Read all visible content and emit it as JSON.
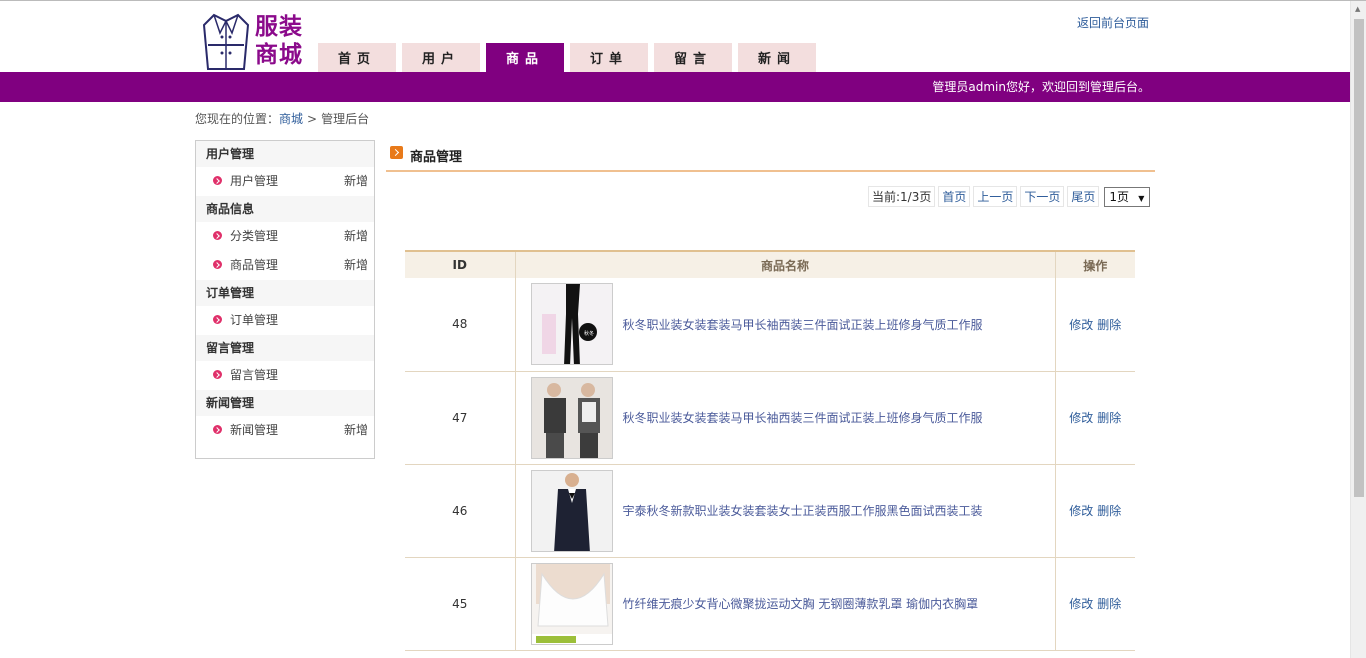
{
  "header": {
    "logo_text_1": "服装",
    "logo_text_2": "商城",
    "back_link": "返回前台页面",
    "nav": [
      {
        "label": "首页",
        "active": false
      },
      {
        "label": "用户",
        "active": false
      },
      {
        "label": "商品",
        "active": true
      },
      {
        "label": "订单",
        "active": false
      },
      {
        "label": "留言",
        "active": false
      },
      {
        "label": "新闻",
        "active": false
      }
    ],
    "welcome": "管理员admin您好，欢迎回到管理后台。"
  },
  "breadcrumb": {
    "prefix": "您现在的位置：",
    "home": "商城",
    "separator": ">",
    "current": "管理后台"
  },
  "sidebar": {
    "groups": [
      {
        "title": "用户管理",
        "items": [
          {
            "label": "用户管理",
            "add": "新增"
          }
        ]
      },
      {
        "title": "商品信息",
        "items": [
          {
            "label": "分类管理",
            "add": "新增"
          },
          {
            "label": "商品管理",
            "add": "新增"
          }
        ]
      },
      {
        "title": "订单管理",
        "items": [
          {
            "label": "订单管理",
            "add": ""
          }
        ]
      },
      {
        "title": "留言管理",
        "items": [
          {
            "label": "留言管理",
            "add": ""
          }
        ]
      },
      {
        "title": "新闻管理",
        "items": [
          {
            "label": "新闻管理",
            "add": "新增"
          }
        ]
      }
    ]
  },
  "main": {
    "title": "商品管理",
    "pager": {
      "info": "当前:1/3页",
      "first": "首页",
      "prev": "上一页",
      "next": "下一页",
      "last": "尾页",
      "selected": "1页"
    },
    "table": {
      "headers": {
        "id": "ID",
        "name": "商品名称",
        "op": "操作"
      },
      "edit_label": "修改",
      "delete_label": "删除",
      "rows": [
        {
          "id": "48",
          "name": "秋冬职业装女装套装马甲长袖西装三件面试正装上班修身气质工作服",
          "thumb": "pants-look"
        },
        {
          "id": "47",
          "name": "秋冬职业装女装套装马甲长袖西装三件面试正装上班修身气质工作服",
          "thumb": "two-models-suit"
        },
        {
          "id": "46",
          "name": "宇泰秋冬新款职业装女装套装女士正装西服工作服黑色面试西装工装",
          "thumb": "black-blazer"
        },
        {
          "id": "45",
          "name": "竹纤维无痕少女背心微聚拢运动文胸 无钢圈薄款乳罩 瑜伽内衣胸罩",
          "thumb": "white-bra"
        }
      ]
    }
  }
}
